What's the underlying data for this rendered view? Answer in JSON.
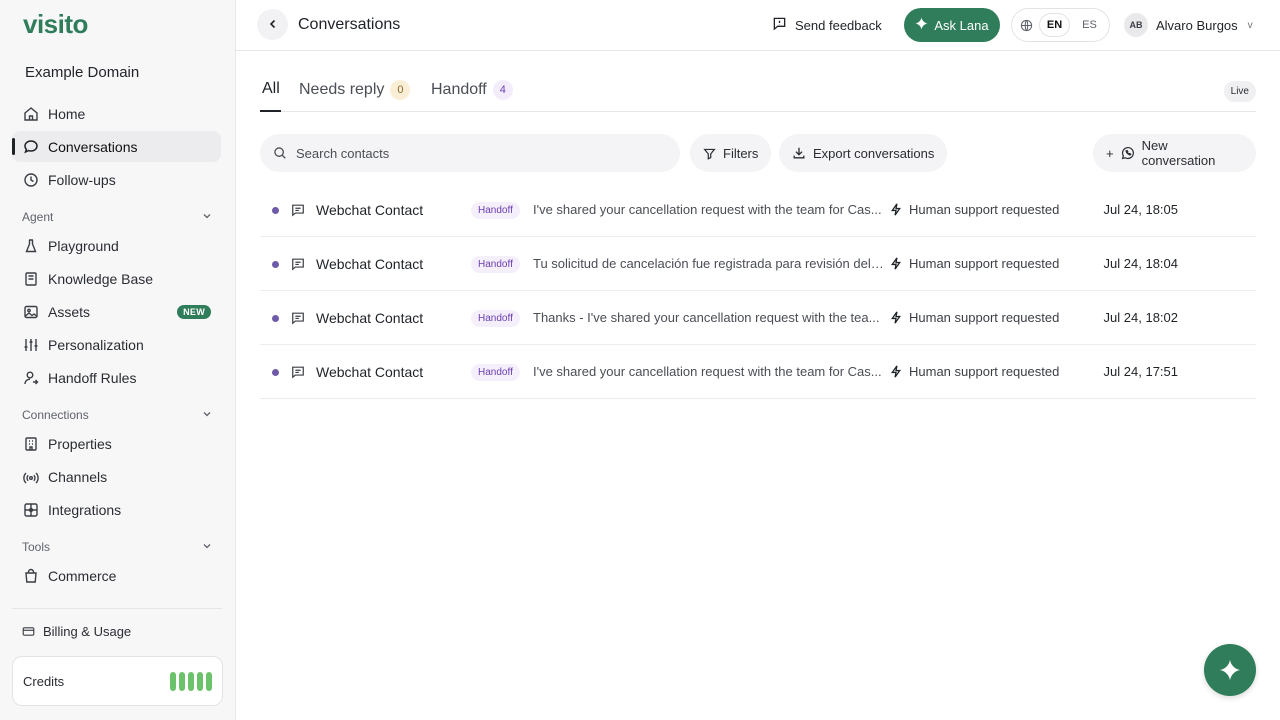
{
  "app": {
    "logo_text": "visito",
    "domain_name": "Example Domain"
  },
  "sidebar": {
    "main_items": [
      {
        "label": "Home",
        "icon": "home-icon"
      },
      {
        "label": "Conversations",
        "icon": "chat-bubble-icon",
        "active": true
      },
      {
        "label": "Follow-ups",
        "icon": "clock-icon"
      }
    ],
    "sections": [
      {
        "title": "Agent",
        "items": [
          {
            "label": "Playground",
            "icon": "flask-icon"
          },
          {
            "label": "Knowledge Base",
            "icon": "book-icon"
          },
          {
            "label": "Assets",
            "icon": "image-icon",
            "badge": "NEW"
          },
          {
            "label": "Personalization",
            "icon": "sliders-icon"
          },
          {
            "label": "Handoff Rules",
            "icon": "user-handoff-icon"
          }
        ]
      },
      {
        "title": "Connections",
        "items": [
          {
            "label": "Properties",
            "icon": "building-icon"
          },
          {
            "label": "Channels",
            "icon": "broadcast-icon"
          },
          {
            "label": "Integrations",
            "icon": "puzzle-icon"
          }
        ]
      },
      {
        "title": "Tools",
        "items": [
          {
            "label": "Commerce",
            "icon": "shopping-bag-icon"
          }
        ]
      }
    ],
    "billing_label": "Billing & Usage",
    "credits_label": "Credits",
    "credits_level": 1.0
  },
  "header": {
    "title": "Conversations",
    "feedback_label": "Send feedback",
    "ask_label": "Ask Lana",
    "languages": [
      "EN",
      "ES"
    ],
    "selected_language": "EN",
    "user_initials": "AB",
    "user_name": "Alvaro Burgos",
    "user_chevron": "v"
  },
  "tabs": [
    {
      "label": "All",
      "active": true
    },
    {
      "label": "Needs reply",
      "count": "0"
    },
    {
      "label": "Handoff",
      "count": "4"
    }
  ],
  "live_label": "Live",
  "toolbar": {
    "search_placeholder": "Search contacts",
    "filters_label": "Filters",
    "export_label": "Export conversations",
    "new_conversation_plus": "+",
    "new_conversation_label": "New conversation"
  },
  "conversations": [
    {
      "contact": "Webchat Contact",
      "tag": "Handoff",
      "message": "I've shared your cancellation request with the team for Cas...",
      "status": "Human support requested",
      "time": "Jul 24, 18:05"
    },
    {
      "contact": "Webchat Contact",
      "tag": "Handoff",
      "message": "Tu solicitud de cancelación fue registrada para revisión del ...",
      "status": "Human support requested",
      "time": "Jul 24, 18:04"
    },
    {
      "contact": "Webchat Contact",
      "tag": "Handoff",
      "message": "Thanks - I've shared your cancellation request with the tea...",
      "status": "Human support requested",
      "time": "Jul 24, 18:02"
    },
    {
      "contact": "Webchat Contact",
      "tag": "Handoff",
      "message": "I've shared your cancellation request with the team for Cas...",
      "status": "Human support requested",
      "time": "Jul 24, 17:51"
    }
  ],
  "colors": {
    "brand_green": "#2f7d5a",
    "handoff_purple": "#6b3fb0",
    "credits_green": "#6cc26b"
  }
}
